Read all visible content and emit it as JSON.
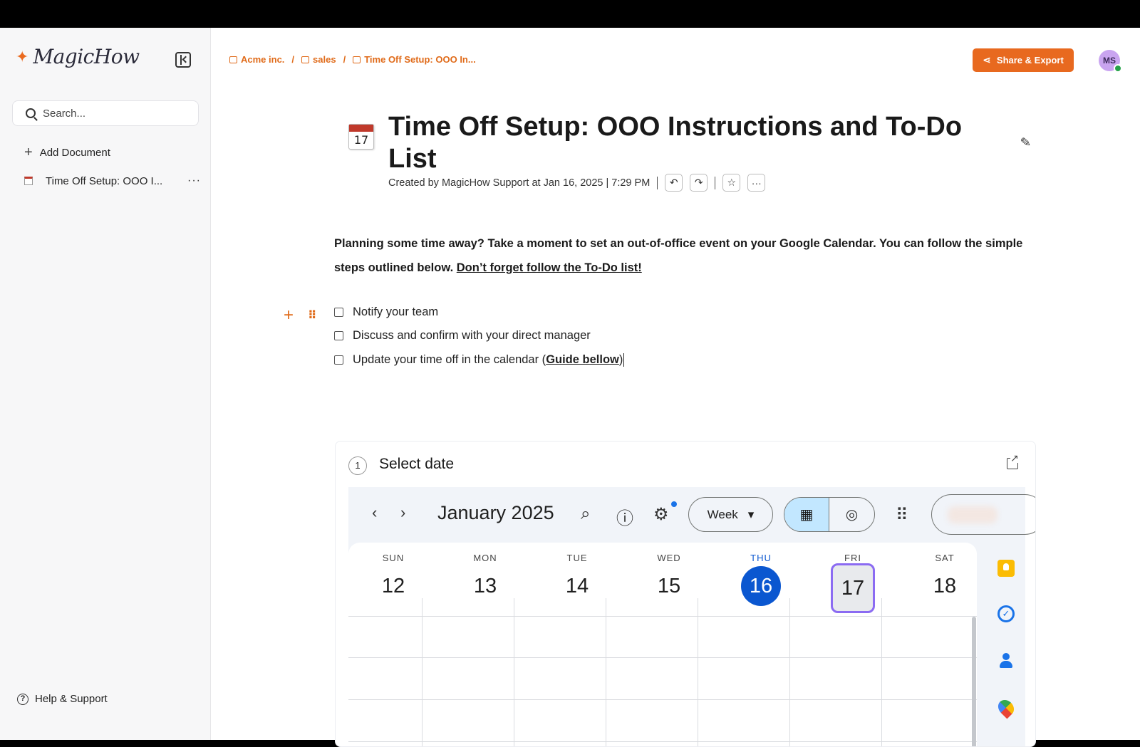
{
  "sidebar": {
    "logo_text": "MagicHow",
    "search_placeholder": "Search...",
    "add_document_label": "Add Document",
    "documents": [
      {
        "label": "Time Off Setup: OOO I..."
      }
    ],
    "doc_more_label": "···",
    "help_label": "Help & Support"
  },
  "header": {
    "breadcrumb": [
      {
        "label": "Acme inc."
      },
      {
        "label": "sales"
      },
      {
        "label": "Time Off Setup: OOO In..."
      }
    ],
    "separator": "/",
    "share_label": "Share & Export",
    "avatar_initials": "MS"
  },
  "document": {
    "icon_day": "17",
    "title": "Time Off Setup: OOO Instructions and To-Do List",
    "meta": "Created by MagicHow Support at Jan 16, 2025 | 7:29 PM",
    "intro_text": "Planning some time away?  Take a moment to set an out-of-office event on your Google Calendar. You can follow the simple steps outlined below. ",
    "intro_link": "Don’t forget follow the To-Do list!",
    "todos": [
      {
        "label": "Notify your team",
        "checked": false
      },
      {
        "label": "Discuss and confirm with your direct manager",
        "checked": false
      },
      {
        "label": "Update your time off in the calendar (",
        "checked": false,
        "link": "Guide bellow",
        "suffix": ")"
      }
    ]
  },
  "step": {
    "number": "1",
    "label": "Select date"
  },
  "calendar": {
    "month_label": "January 2025",
    "view_label": "Week",
    "days": [
      {
        "name": "SUN",
        "num": "12"
      },
      {
        "name": "MON",
        "num": "13"
      },
      {
        "name": "TUE",
        "num": "14"
      },
      {
        "name": "WED",
        "num": "15"
      },
      {
        "name": "THU",
        "num": "16",
        "today": true
      },
      {
        "name": "FRI",
        "num": "17",
        "selected": true
      },
      {
        "name": "SAT",
        "num": "18"
      }
    ],
    "accent_color": "#0b57d0",
    "selection_color": "#8b6bf2"
  },
  "colors": {
    "brand": "#e8691f"
  }
}
